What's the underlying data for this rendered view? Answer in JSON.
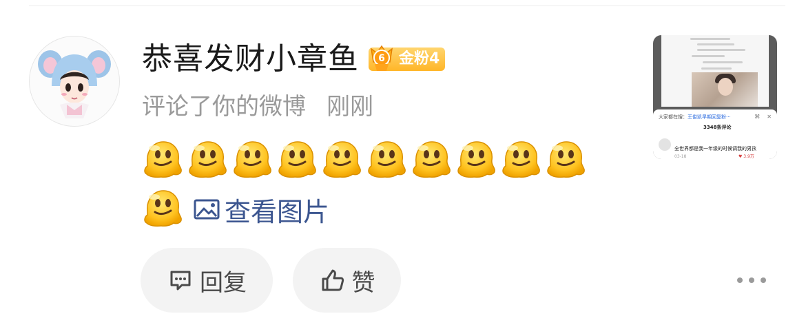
{
  "comment": {
    "user_name": "恭喜发财小章鱼",
    "fan_badge": {
      "label": "金粉4",
      "icon": "crown-trophy-icon",
      "icon_number": "6",
      "color": "#ffb628"
    },
    "action_text": "评论了你的微博",
    "time": "刚刚",
    "emoji_name": "melting-face-emoji",
    "emoji_count": 11,
    "view_images_label": "查看图片",
    "link_color": "#3c5690"
  },
  "thumbnail": {
    "search_prefix": "大家都在搜：",
    "search_term": "王俊凯早期回复粉···",
    "comment_count": "3348条评论",
    "top_comment": "全世界都是我一年级的时候调我的男孩",
    "date": "03-18",
    "likes": "3.9万"
  },
  "actions": {
    "reply_label": "回复",
    "like_label": "赞",
    "more_icon": "more-dots-icon"
  }
}
